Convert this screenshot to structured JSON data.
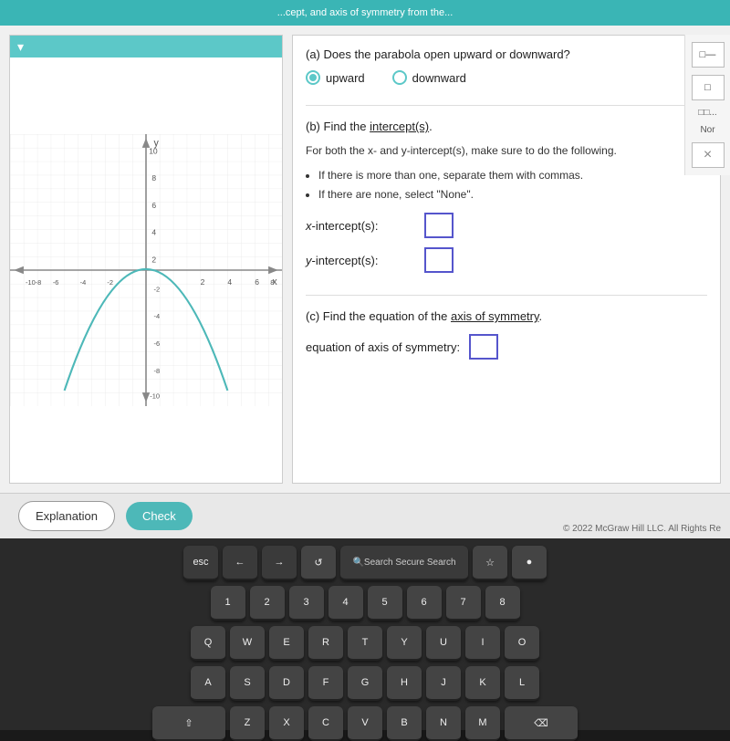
{
  "topbar": {
    "text": "...cept, and axis of symmetry from the..."
  },
  "questions": {
    "a": {
      "title": "(a) Does the parabola open upward or downward?",
      "option_upward": "upward",
      "option_downward": "downward",
      "upward_selected": true
    },
    "b": {
      "title": "(b) Find the intercept(s).",
      "instruction": "For both the x- and y-intercept(s), make sure to do the following.",
      "bullets": [
        "If there is more than one, separate them with commas.",
        "If there are none, select \"None\"."
      ],
      "x_label": "x-intercept(s):",
      "y_label": "y-intercept(s):"
    },
    "c": {
      "title": "(c) Find the equation of the axis of symmetry.",
      "label": "equation of axis of symmetry:"
    }
  },
  "toolbar": {
    "icon1": "□□",
    "icon2": "□",
    "label_nor": "Nor",
    "close": "×"
  },
  "bottom": {
    "explanation_label": "Explanation",
    "check_label": "Check",
    "copyright": "© 2022 McGraw Hill LLC. All Rights Re"
  },
  "keyboard": {
    "search_label": "Search Secure Search",
    "row1": [
      "esc",
      "←",
      "→",
      "↺",
      "⇧"
    ],
    "row2": [
      "1",
      "2",
      "3",
      "4",
      "5",
      "6",
      "7",
      "8"
    ],
    "special_keys": [
      "esc",
      "←",
      "→",
      "↺",
      "⇧",
      "☆",
      "●"
    ]
  }
}
